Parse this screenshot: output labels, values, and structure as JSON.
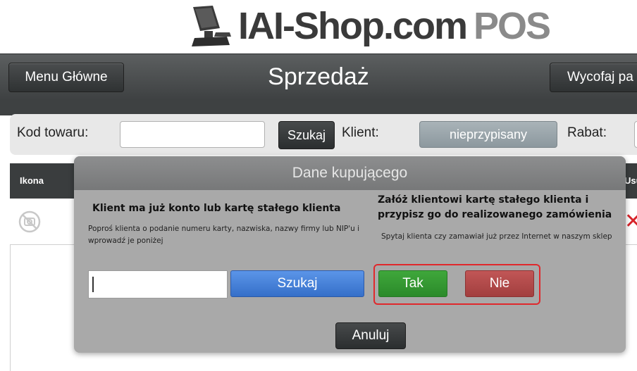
{
  "logo": {
    "brand": "IAI-Shop.com",
    "suffix": "POS",
    "icon": "pos-terminal-icon"
  },
  "header": {
    "menu_label": "Menu Główne",
    "title": "Sprzedaż",
    "undo_label": "Wycofaj pa"
  },
  "search": {
    "product_code_label": "Kod towaru:",
    "product_code_value": "",
    "search_label": "Szukaj",
    "client_label": "Klient:",
    "client_value": "nieprzypisany",
    "discount_label": "Rabat:"
  },
  "table": {
    "columns": [
      "Ikona",
      "Usu"
    ],
    "rows": [
      {
        "icon": "no-image-icon",
        "delete_icon": "delete-x-icon"
      }
    ]
  },
  "modal": {
    "title": "Dane kupującego",
    "existing": {
      "heading": "Klient ma już konto lub kartę stałego klienta",
      "hint": "Poproś klienta o podanie numeru karty, nazwiska, nazwy firmy lub NIP'u i wprowadź je poniżej",
      "input_value": "",
      "search_label": "Szukaj"
    },
    "new_card": {
      "heading": "Załóż klientowi kartę stałego klienta i przypisz go do realizowanego zamówienia",
      "hint": "Spytaj klienta czy zamawiał już przez Internet w naszym sklep",
      "yes_label": "Tak",
      "no_label": "Nie"
    },
    "cancel_label": "Anuluj"
  },
  "colors": {
    "header_bg": "#4a4d4e",
    "search_btn_blue": "#356fc9",
    "yes_green": "#2b8a2a",
    "no_red": "#a23f3f",
    "highlight_red": "#e0282c",
    "delete_red": "#d8232a"
  }
}
